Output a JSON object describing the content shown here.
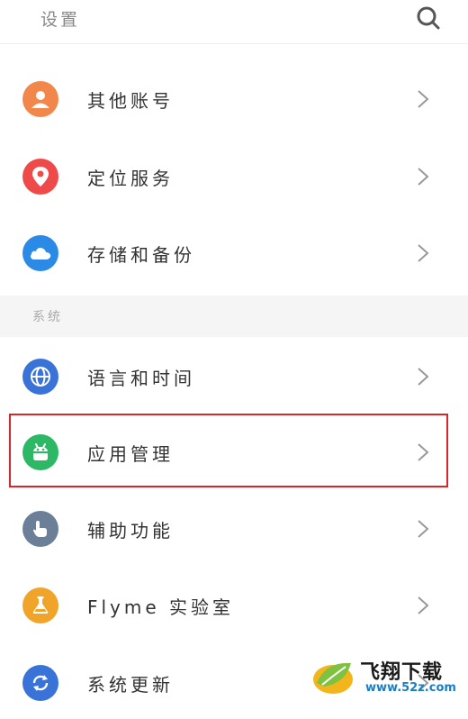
{
  "header": {
    "title": "设置",
    "search_icon": "search-icon"
  },
  "rows_top": [
    {
      "label": "其他账号",
      "icon": "account-icon",
      "color": "#f2874b"
    },
    {
      "label": "定位服务",
      "icon": "location-icon",
      "color": "#ef4a4a"
    },
    {
      "label": "存储和备份",
      "icon": "cloud-icon",
      "color": "#2b8ae6"
    }
  ],
  "section": {
    "title": "系统"
  },
  "rows_system": [
    {
      "label": "语言和时间",
      "icon": "globe-icon",
      "color": "#3a73d8"
    },
    {
      "label": "应用管理",
      "icon": "android-icon",
      "color": "#2db866"
    },
    {
      "label": "辅助功能",
      "icon": "hand-icon",
      "color": "#6c7f99"
    },
    {
      "label": "Flyme 实验室",
      "icon": "flask-icon",
      "color": "#f0a52a"
    },
    {
      "label": "系统更新",
      "icon": "refresh-icon",
      "color": "#3a73d8"
    }
  ],
  "watermark": {
    "brand": "飞翔下载",
    "site": "www.52z.com"
  }
}
